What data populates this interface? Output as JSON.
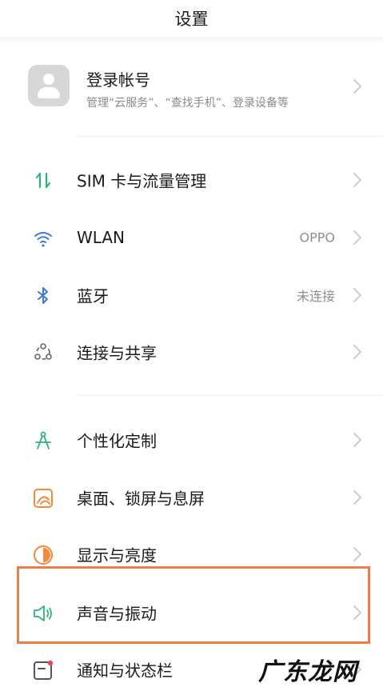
{
  "header": {
    "title": "设置"
  },
  "account": {
    "title": "登录帐号",
    "subtitle": "管理“云服务”、“查找手机”、登录设备等",
    "avatar_icon": "person-icon"
  },
  "settings": [
    {
      "id": "sim",
      "label": "SIM 卡与流量管理",
      "value": "",
      "icon": "sim-data-icon",
      "color": "#2bb57a"
    },
    {
      "id": "wlan",
      "label": "WLAN",
      "value": "OPPO",
      "icon": "wifi-icon",
      "color": "#3a7bd5"
    },
    {
      "id": "bluetooth",
      "label": "蓝牙",
      "value": "未连接",
      "icon": "bluetooth-icon",
      "color": "#3a7bd5"
    },
    {
      "id": "connection",
      "label": "连接与共享",
      "value": "",
      "icon": "share-connection-icon",
      "color": "#666666"
    },
    {
      "id": "personalize",
      "label": "个性化定制",
      "value": "",
      "icon": "compass-icon",
      "color": "#2bb57a"
    },
    {
      "id": "desktop",
      "label": "桌面、锁屏与息屏",
      "value": "",
      "icon": "wallpaper-icon",
      "color": "#f08a3c"
    },
    {
      "id": "display",
      "label": "显示与亮度",
      "value": "",
      "icon": "brightness-icon",
      "color": "#f08a3c"
    },
    {
      "id": "sound",
      "label": "声音与振动",
      "value": "",
      "icon": "speaker-icon",
      "color": "#2bb57a"
    },
    {
      "id": "notification",
      "label": "通知与状态栏",
      "value": "",
      "icon": "notification-icon",
      "color": "#e8465a"
    }
  ],
  "colors": {
    "highlight": "#ee7c4a",
    "chevron": "#c6c6c6"
  },
  "watermark": {
    "text": "广东龙网"
  }
}
